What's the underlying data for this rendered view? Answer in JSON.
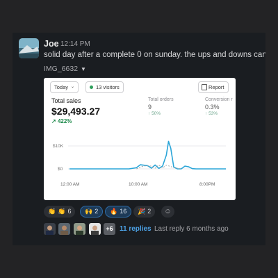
{
  "message": {
    "author": "Joe",
    "time": "12:14 PM",
    "text": "solid day after a complete 0 on sunday. the ups and downs can",
    "attachment_name": "IMG_6632"
  },
  "card": {
    "date_filter": "Today",
    "visitors_label": "13 visitors",
    "report_label": "Report",
    "total_sales_label": "Total sales",
    "total_sales_value": "$29,493.27",
    "total_sales_change": "422%",
    "total_orders_label": "Total orders",
    "total_orders_value": "9",
    "total_orders_change": "50%",
    "conversion_label": "Conversion r",
    "conversion_value": "0.3%",
    "conversion_change": "53%"
  },
  "chart_data": {
    "type": "line",
    "yticks": [
      "$10K",
      "$0"
    ],
    "xticks": [
      "12:00 AM",
      "10:00 AM",
      "8:00PM"
    ],
    "ylim": [
      0,
      15000
    ],
    "series": [
      {
        "style": "solid",
        "color": "#2aa5d8",
        "x": [
          0,
          1,
          2,
          3,
          4,
          5,
          6,
          7,
          8,
          9,
          9.5,
          10,
          10.5,
          11,
          11.5,
          12,
          12.5,
          13,
          13.3,
          13.6,
          14,
          14.5,
          15,
          15.5,
          16,
          16.5,
          17,
          18,
          19,
          20,
          21
        ],
        "values": [
          0,
          0,
          0,
          0,
          0,
          0,
          0,
          0,
          0,
          500,
          1800,
          1600,
          1400,
          300,
          1700,
          200,
          1200,
          6000,
          12000,
          9000,
          800,
          0,
          0,
          1200,
          900,
          100,
          0,
          0,
          0,
          0,
          0
        ]
      },
      {
        "style": "dashed",
        "color": "#9fa4a8",
        "x": [
          9,
          10,
          11,
          11.5,
          12,
          12.5,
          13,
          14,
          15
        ],
        "values": [
          0,
          1300,
          1200,
          300,
          1700,
          400,
          1600,
          600,
          0
        ]
      }
    ]
  },
  "reactions": [
    {
      "emoji": "👏",
      "emoji2": "👏",
      "count": "6",
      "selected": false
    },
    {
      "emoji": "🙌",
      "count": "2",
      "selected": true
    },
    {
      "emoji": "🔥",
      "count": "16",
      "selected": true
    },
    {
      "emoji": "🎉",
      "count": "2",
      "selected": false
    }
  ],
  "thread": {
    "more_count": "+6",
    "replies_label": "11 replies",
    "last_reply": "Last reply 6 months ago"
  },
  "colors": {
    "background": "#1a1d21",
    "link": "#4da3e8",
    "positive": "#1f8a4c",
    "chart_line": "#2aa5d8"
  }
}
